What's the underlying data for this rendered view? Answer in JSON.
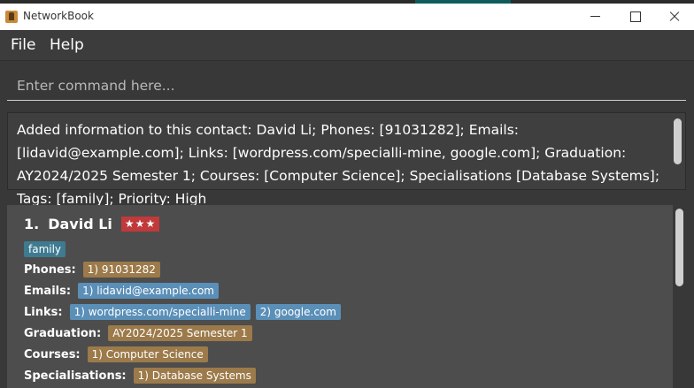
{
  "window": {
    "title": "NetworkBook"
  },
  "menu": {
    "file": "File",
    "help": "Help"
  },
  "command": {
    "placeholder": "Enter command here...",
    "value": ""
  },
  "result": {
    "text": "Added information to this contact: David Li; Phones: [91031282]; Emails: [lidavid@example.com]; Links: [wordpress.com/specialli-mine, google.com]; Graduation: AY2024/2025 Semester 1; Courses: [Computer Science]; Specialisations [Database Systems]; Tags: [family]; Priority: High"
  },
  "contact": {
    "index": "1.",
    "name": "David Li",
    "priority": "★★★",
    "tags": [
      "family"
    ],
    "labels": {
      "phones": "Phones:",
      "emails": "Emails:",
      "links": "Links:",
      "graduation": "Graduation:",
      "courses": "Courses:",
      "specialisations": "Specialisations:"
    },
    "phones": [
      "1) 91031282"
    ],
    "emails": [
      "1) lidavid@example.com"
    ],
    "links": [
      "1) wordpress.com/specialli-mine",
      "2) google.com"
    ],
    "graduation": "AY2024/2025 Semester 1",
    "courses": [
      "1) Computer Science"
    ],
    "specialisations": [
      "1) Database Systems"
    ]
  },
  "colors": {
    "priority_high": "#c0393b",
    "tag": "#3e7b91",
    "chip_brown": "#9c7a4a",
    "chip_blue": "#5a8fb8"
  }
}
